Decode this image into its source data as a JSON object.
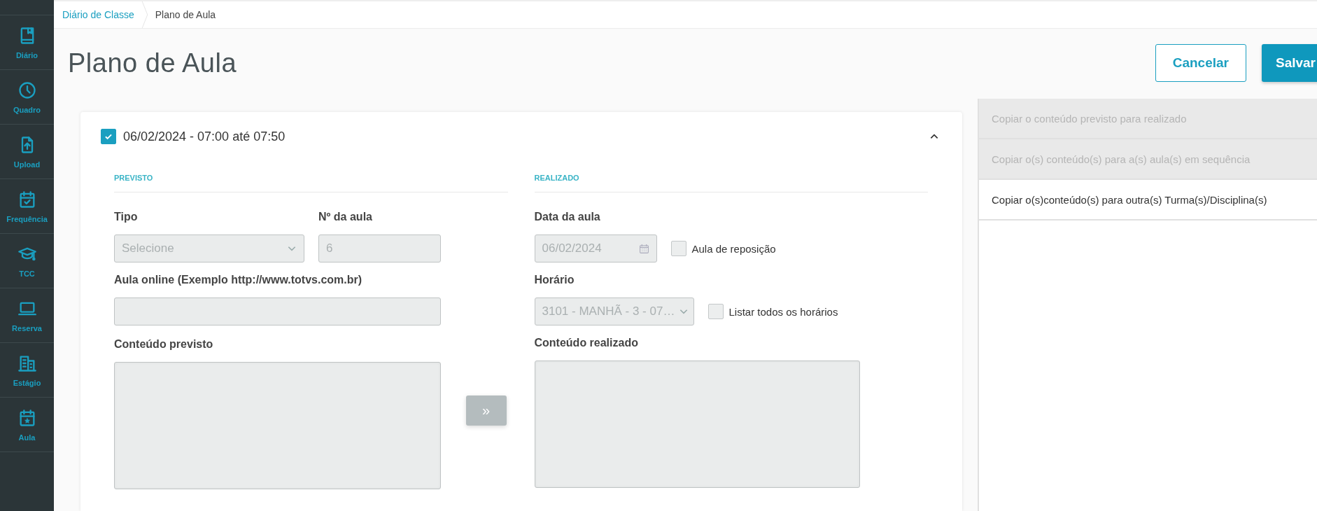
{
  "sidebar": {
    "items": [
      {
        "label": "Diário",
        "selected": false
      },
      {
        "label": "Quadro",
        "selected": false
      },
      {
        "label": "Upload",
        "selected": false
      },
      {
        "label": "Frequência",
        "selected": false
      },
      {
        "label": "TCC",
        "selected": false
      },
      {
        "label": "Reserva",
        "selected": false
      },
      {
        "label": "Estágio",
        "selected": false
      },
      {
        "label": "Aula",
        "selected": false
      }
    ]
  },
  "breadcrumb": [
    {
      "label": "Diário de Classe",
      "current": false
    },
    {
      "label": "Plano de Aula",
      "current": true
    }
  ],
  "page_title": "Plano de Aula",
  "actions": [
    {
      "label": "Cancelar",
      "kind": "outline"
    },
    {
      "label": "Salvar",
      "kind": "primary"
    }
  ],
  "lesson": {
    "checked": true,
    "title": "06/02/2024 - 07:00 até 07:50",
    "expanded": true,
    "previsto": {
      "heading": "PREVISTO",
      "tipo": {
        "label": "Tipo",
        "placeholder": "Selecione",
        "disabled": true
      },
      "numero": {
        "label": "Nº da aula",
        "value": "6",
        "disabled": true
      },
      "online": {
        "label": "Aula online (Exemplo http://www.totvs.com.br)",
        "disabled": true
      },
      "conteudo": {
        "label": "Conteúdo previsto",
        "disabled": true
      }
    },
    "copy_button": {
      "label": "»",
      "disabled": true
    },
    "realizado": {
      "heading": "REALIZADO",
      "data": {
        "label": "Data da aula",
        "value": "06/02/2024",
        "disabled": true
      },
      "reposicao": {
        "label": "Aula de reposição",
        "checked": false
      },
      "horario": {
        "label": "Horário",
        "value": "3101 - MANHÃ - 3 - 07…",
        "disabled": true
      },
      "listar": {
        "label": "Listar todos os horários",
        "checked": false
      },
      "conteudo": {
        "label": "Conteúdo realizado",
        "disabled": true
      }
    }
  },
  "side_actions": [
    {
      "label": "Copiar o conteúdo previsto para realizado",
      "disabled": true
    },
    {
      "label": "Copiar o(s) conteúdo(s) para a(s) aula(s) em sequência",
      "disabled": true
    },
    {
      "label": "Copiar o(s)conteúdo(s) para outra(s) Turma(s)/Disciplina(s)",
      "disabled": false
    }
  ]
}
